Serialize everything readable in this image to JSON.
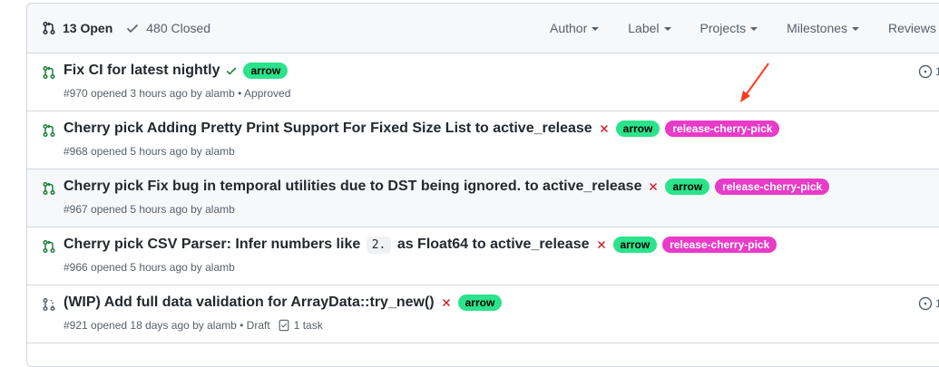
{
  "header": {
    "open_label": "13 Open",
    "closed_label": "480 Closed",
    "filters": [
      "Author",
      "Label",
      "Projects",
      "Milestones",
      "Reviews"
    ]
  },
  "colors": {
    "open_icon": "#1a7f37",
    "check": "#1a7f37",
    "x": "#cf222e",
    "arrow_label_bg": "#2be38a",
    "cherry_label_bg": "#e93ac8",
    "annotation_arrow": "#ff3b21"
  },
  "rows": [
    {
      "title": "Fix CI for latest nightly",
      "status": "check",
      "labels": [
        {
          "text": "arrow",
          "kind": "arrow"
        }
      ],
      "meta": "#970 opened 3 hours ago by alamb • Approved",
      "comment": "1"
    },
    {
      "title": "Cherry pick Adding Pretty Print Support For Fixed Size List to active_release",
      "status": "x",
      "labels": [
        {
          "text": "arrow",
          "kind": "arrow"
        },
        {
          "text": "release-cherry-pick",
          "kind": "cherry"
        }
      ],
      "meta": "#968 opened 5 hours ago by alamb"
    },
    {
      "title": "Cherry pick Fix bug in temporal utilities due to DST being ignored. to active_release",
      "status": "x",
      "labels": [
        {
          "text": "arrow",
          "kind": "arrow"
        },
        {
          "text": "release-cherry-pick",
          "kind": "cherry"
        }
      ],
      "meta": "#967 opened 5 hours ago by alamb"
    },
    {
      "title_before": "Cherry pick CSV Parser: Infer numbers like",
      "title_code": "2.",
      "title_after": "as Float64 to active_release",
      "status": "x",
      "labels": [
        {
          "text": "arrow",
          "kind": "arrow"
        },
        {
          "text": "release-cherry-pick",
          "kind": "cherry"
        }
      ],
      "meta": "#966 opened 5 hours ago by alamb"
    },
    {
      "title": "(WIP) Add full data validation for ArrayData::try_new()",
      "status": "x",
      "draft": true,
      "labels": [
        {
          "text": "arrow",
          "kind": "arrow"
        }
      ],
      "meta": "#921 opened 18 days ago by alamb • Draft",
      "tasks": "1 task",
      "comment": "1"
    }
  ]
}
